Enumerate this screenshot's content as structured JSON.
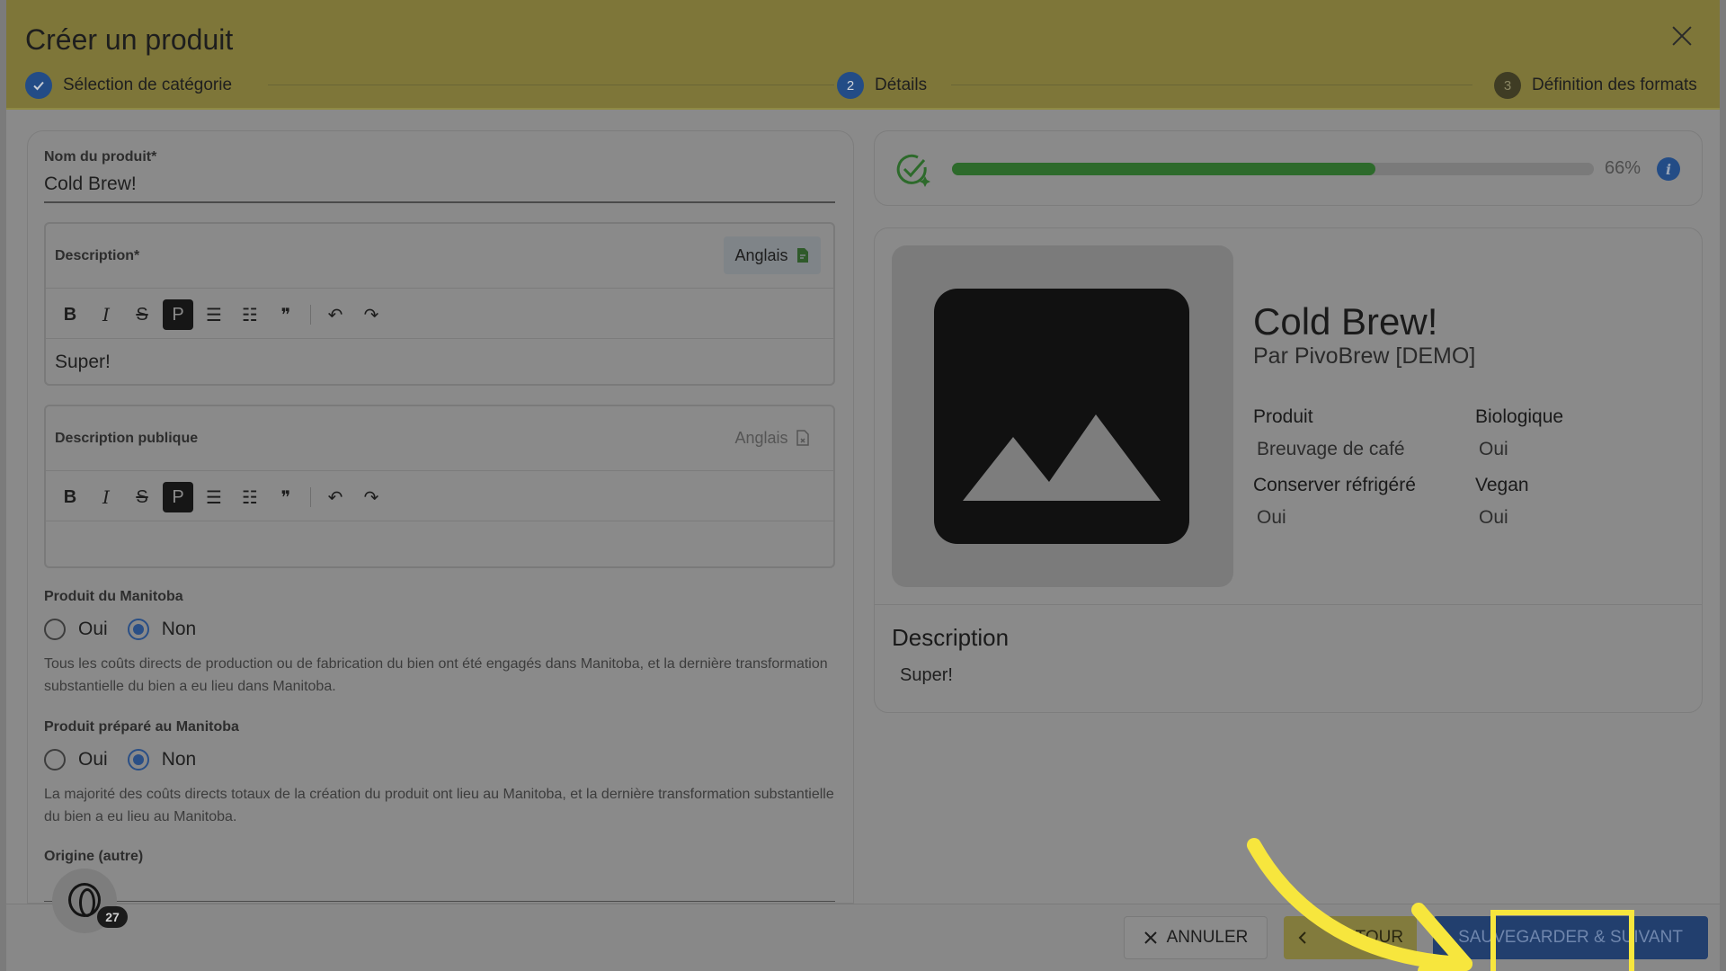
{
  "header": {
    "title": "Créer un produit",
    "steps": [
      {
        "label": "Sélection de catégorie",
        "state": "done",
        "number": ""
      },
      {
        "label": "Détails",
        "state": "active",
        "number": "2"
      },
      {
        "label": "Définition des formats",
        "state": "todo",
        "number": "3"
      }
    ]
  },
  "form": {
    "product_name_label": "Nom du produit*",
    "product_name_value": "Cold Brew!",
    "description": {
      "label": "Description*",
      "language_button": "Anglais",
      "content": "Super!"
    },
    "public_description": {
      "label": "Description publique",
      "language_button": "Anglais",
      "content": ""
    },
    "toolbar": {
      "bold": "B",
      "italic": "I",
      "strike": "S",
      "paragraph": "P",
      "bullet_list": "☰",
      "ordered_list": "☷",
      "quote": "❞",
      "undo": "↶",
      "redo": "↷"
    },
    "manitoba_product": {
      "label": "Produit du Manitoba",
      "options": [
        "Oui",
        "Non"
      ],
      "selected": "Non",
      "hint": "Tous les coûts directs de production ou de fabrication du bien ont été engagés dans Manitoba, et la dernière transformation substantielle du bien a eu lieu dans Manitoba."
    },
    "manitoba_prepared": {
      "label": "Produit préparé au Manitoba",
      "options": [
        "Oui",
        "Non"
      ],
      "selected": "Non",
      "hint": "La majorité des coûts directs totaux de la création du produit ont lieu au Manitoba, et la dernière transformation substantielle du bien a eu lieu au Manitoba."
    },
    "origin_label": "Origine (autre)"
  },
  "progress": {
    "percent_label": "66%",
    "fraction": 0.66,
    "fill_color": "#2d6a2b"
  },
  "preview": {
    "name": "Cold Brew!",
    "by": "Par PivoBrew [DEMO]",
    "attributes": [
      {
        "label": "Produit",
        "value": "Breuvage de café"
      },
      {
        "label": "Biologique",
        "value": "Oui"
      },
      {
        "label": "Conserver réfrigéré",
        "value": "Oui"
      },
      {
        "label": "Vegan",
        "value": "Oui"
      }
    ],
    "description_title": "Description",
    "description_text": "Super!"
  },
  "footer": {
    "cancel_label": "ANNULER",
    "back_label": "RETOUR",
    "back_visible_text": "ETOUR",
    "save_label": "SAUVEGARDER & SUIVANT"
  },
  "support_widget": {
    "badge_count": "27"
  },
  "colors": {
    "accent_blue": "#234c86",
    "highlight_yellow": "#f7e63d",
    "header_overlay": "#7e7639"
  }
}
